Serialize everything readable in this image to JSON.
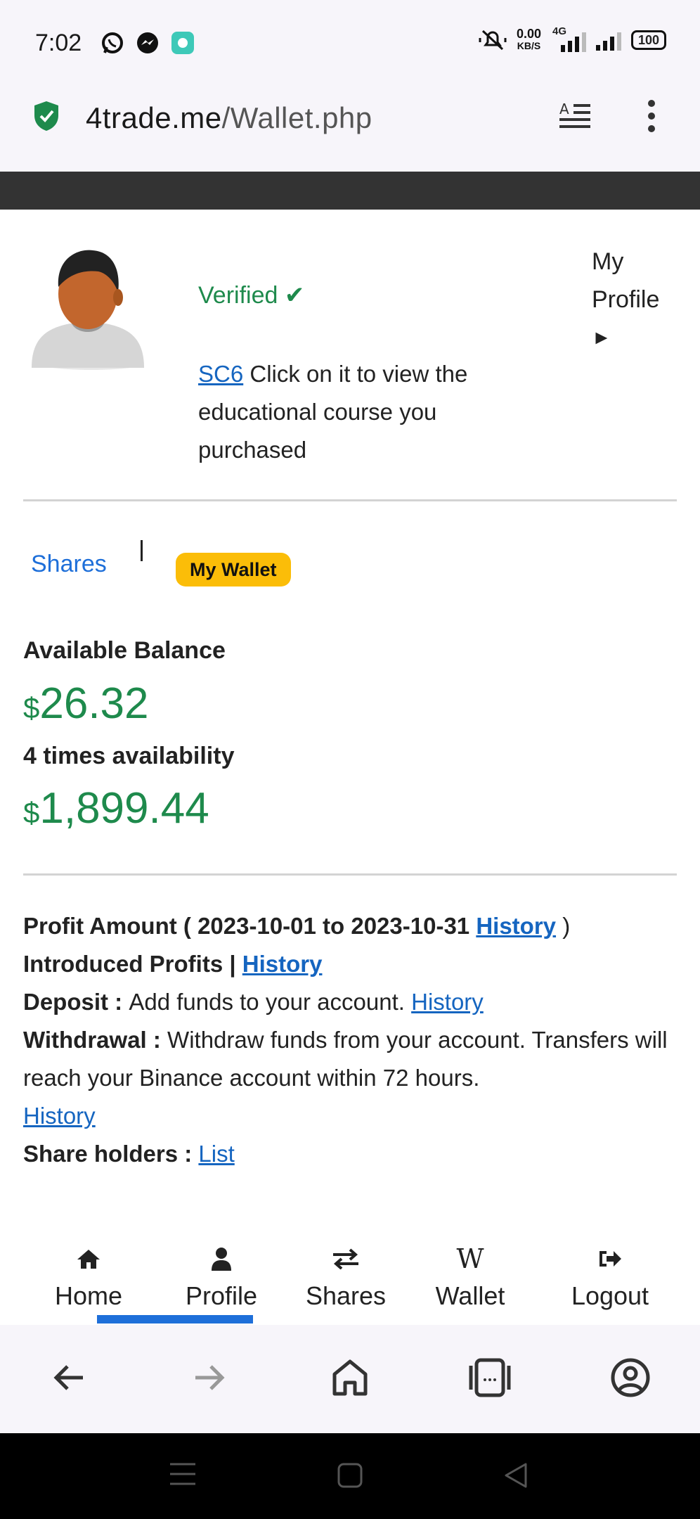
{
  "status_bar": {
    "time": "7:02",
    "net_speed_value": "0.00",
    "net_speed_unit": "KB/S",
    "network_type": "4G",
    "battery": "100"
  },
  "browser": {
    "url_host": "4trade.me",
    "url_path": "/Wallet.php"
  },
  "profile": {
    "verified_text": "Verified ✔",
    "course_link": "SC6",
    "course_text": " Click on it to view the educational course you purchased",
    "my_profile_label": "My Profile",
    "my_profile_arrow": "►"
  },
  "tabs": {
    "shares_label": "Shares",
    "wallet_label": "My Wallet"
  },
  "balances": {
    "available_label": "Available Balance",
    "available_currency": "$",
    "available_value": "26.32",
    "times_label": "4 times availability",
    "times_currency": "$",
    "times_value": "1,899.44"
  },
  "info": {
    "profit_prefix": "Profit Amount ( 2023-10-01 to 2023-10-31 ",
    "profit_history_link": "History",
    "profit_suffix": " )",
    "introduced_label": "Introduced Profits | ",
    "introduced_history_link": "History",
    "deposit_label": "Deposit : ",
    "deposit_text": "Add funds to your account. ",
    "deposit_history_link": "History",
    "withdrawal_label": "Withdrawal : ",
    "withdrawal_text": "Withdraw funds from your account. Transfers will reach your Binance account within 72 hours.",
    "withdrawal_history_link": "History",
    "shareholders_label": "Share holders : ",
    "shareholders_link": "List"
  },
  "site_nav": {
    "items": [
      {
        "label": "Home",
        "icon": "home-icon"
      },
      {
        "label": "Profile",
        "icon": "user-icon"
      },
      {
        "label": "Shares",
        "icon": "exchange-icon"
      },
      {
        "label": "Wallet",
        "icon": "wikipedia-w-icon",
        "glyph": "W"
      },
      {
        "label": "Logout",
        "icon": "sign-out-icon"
      }
    ]
  },
  "colors": {
    "accent_green": "#1e8a4c",
    "link_blue": "#1565c0",
    "wallet_badge": "#fbbd08",
    "nav_underline": "#1e6fd9"
  }
}
